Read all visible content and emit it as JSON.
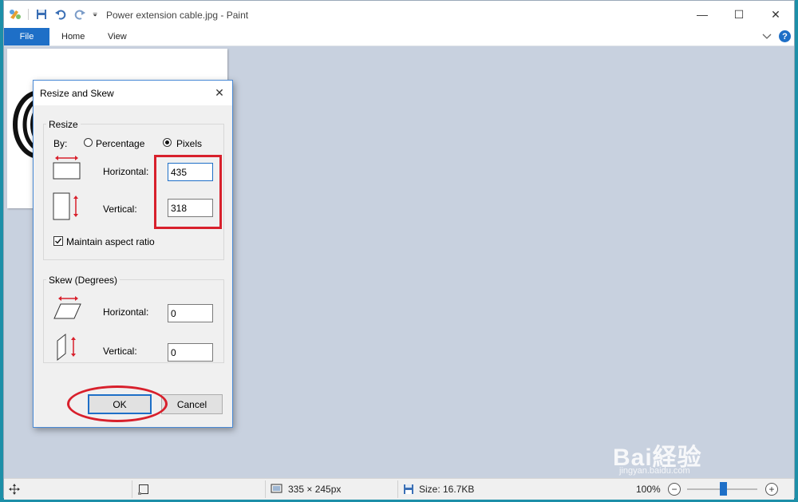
{
  "window": {
    "title": "Power extension cable.jpg - Paint",
    "controls": {
      "minimize": "—",
      "maximize": "☐",
      "close": "✕"
    }
  },
  "ribbon": {
    "tabs": [
      "File",
      "Home",
      "View"
    ],
    "help": "?"
  },
  "statusbar": {
    "dimensions": "335 × 245px",
    "size": "Size: 16.7KB",
    "zoom": "100%",
    "zoom_minus": "−",
    "zoom_plus": "+",
    "zoom_level": 0.52
  },
  "dialog": {
    "title": "Resize and Skew",
    "close": "✕",
    "resize": {
      "label": "Resize",
      "by_label": "By:",
      "percentage_label": "Percentage",
      "pixels_label": "Pixels",
      "selected": "Pixels",
      "horizontal_label": "Horizontal:",
      "horizontal_value": "435",
      "vertical_label": "Vertical:",
      "vertical_value": "318",
      "maintain_label": "Maintain aspect ratio",
      "maintain_checked": true
    },
    "skew": {
      "label": "Skew (Degrees)",
      "horizontal_label": "Horizontal:",
      "horizontal_value": "0",
      "vertical_label": "Vertical:",
      "vertical_value": "0"
    },
    "ok_label": "OK",
    "cancel_label": "Cancel"
  },
  "watermark": {
    "brand": "Bai経验",
    "url": "jingyan.baidu.com"
  },
  "colors": {
    "accent": "#1e6fc7",
    "annotation": "#d8202c",
    "workspace": "#c8d1df"
  }
}
